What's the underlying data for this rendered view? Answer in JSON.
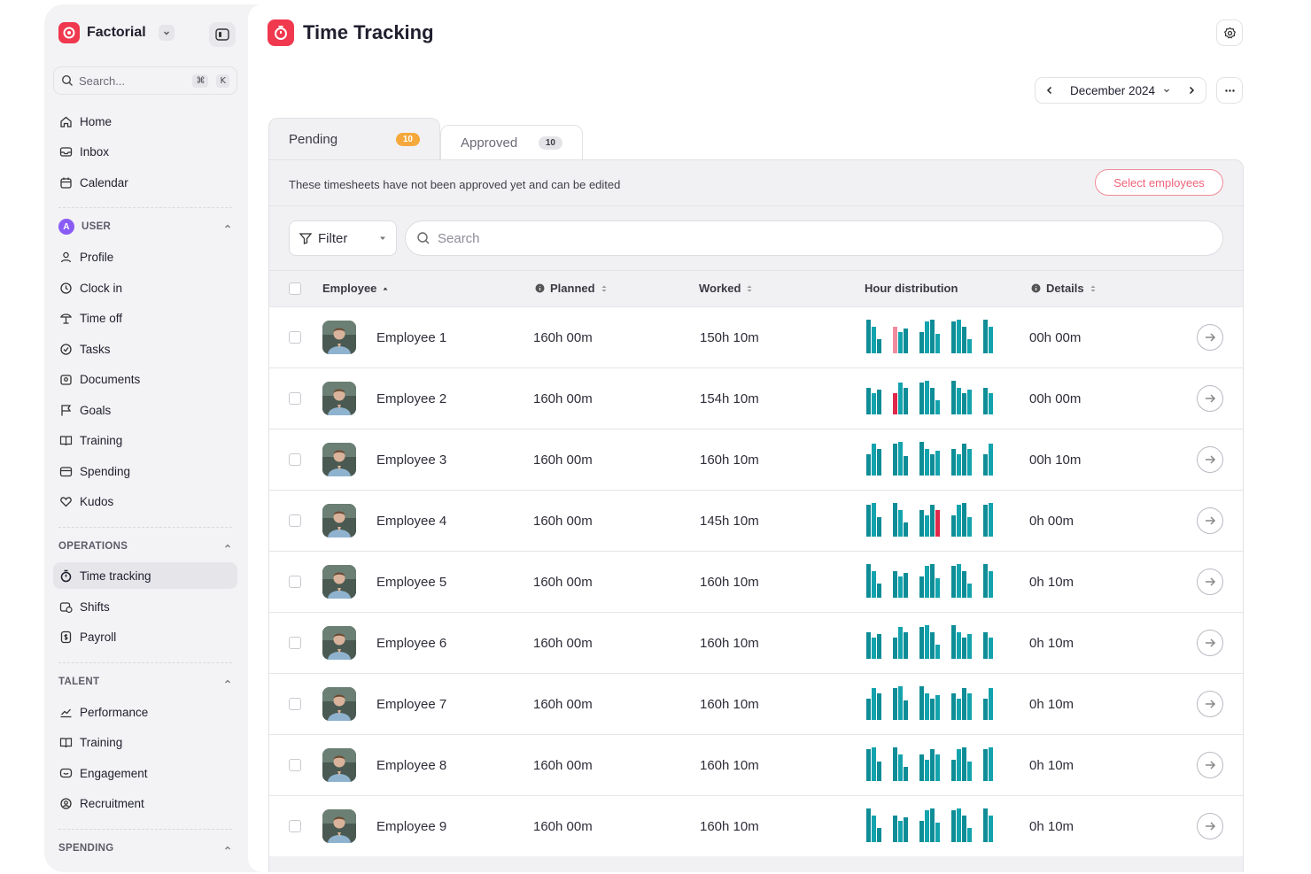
{
  "brand": {
    "name": "Factorial"
  },
  "sidebar": {
    "search_placeholder": "Search...",
    "shortcut": [
      "⌘",
      "K"
    ],
    "top_items": [
      {
        "label": "Home",
        "icon": "home-icon"
      },
      {
        "label": "Inbox",
        "icon": "inbox-icon"
      },
      {
        "label": "Calendar",
        "icon": "calendar-icon"
      }
    ],
    "sections": [
      {
        "title": "USER",
        "badge": "A",
        "items": [
          {
            "label": "Profile",
            "icon": "profile-icon"
          },
          {
            "label": "Clock in",
            "icon": "clock-icon"
          },
          {
            "label": "Time off",
            "icon": "time-off-icon"
          },
          {
            "label": "Tasks",
            "icon": "tasks-icon"
          },
          {
            "label": "Documents",
            "icon": "documents-icon"
          },
          {
            "label": "Goals",
            "icon": "flag-icon"
          },
          {
            "label": "Training",
            "icon": "book-icon"
          },
          {
            "label": "Spending",
            "icon": "wallet-icon"
          },
          {
            "label": "Kudos",
            "icon": "heart-icon"
          }
        ]
      },
      {
        "title": "OPERATIONS",
        "items": [
          {
            "label": "Time tracking",
            "icon": "stopwatch-icon",
            "active": true
          },
          {
            "label": "Shifts",
            "icon": "shifts-icon"
          },
          {
            "label": "Payroll",
            "icon": "payroll-icon"
          }
        ]
      },
      {
        "title": "TALENT",
        "items": [
          {
            "label": "Performance",
            "icon": "performance-icon"
          },
          {
            "label": "Training",
            "icon": "book-icon"
          },
          {
            "label": "Engagement",
            "icon": "engagement-icon"
          },
          {
            "label": "Recruitment",
            "icon": "recruitment-icon"
          }
        ]
      },
      {
        "title": "SPENDING",
        "items": []
      }
    ]
  },
  "header": {
    "title": "Time Tracking",
    "month": "December 2024"
  },
  "tabs": [
    {
      "label": "Pending",
      "count": "10",
      "active": true
    },
    {
      "label": "Approved",
      "count": "10",
      "active": false
    }
  ],
  "panel": {
    "note": "These timesheets have not been approved yet and can be edited",
    "select_button": "Select employees",
    "filter_label": "Filter",
    "search_placeholder": "Search"
  },
  "table": {
    "columns": {
      "employee": "Employee",
      "planned": "Planned",
      "worked": "Worked",
      "distribution": "Hour distribution",
      "details": "Details"
    },
    "rows": [
      {
        "name": "Employee 1",
        "planned": "160h 00m",
        "worked": "150h 10m",
        "details": "00h 00m",
        "alert_bar": 3,
        "alert_color": "#f28b9f"
      },
      {
        "name": "Employee 2",
        "planned": "160h 00m",
        "worked": "154h 10m",
        "details": "00h 00m",
        "alert_bar": 3,
        "alert_color": "#e0284a"
      },
      {
        "name": "Employee 3",
        "planned": "160h 00m",
        "worked": "160h 10m",
        "details": "00h 10m",
        "alert_bar": -1,
        "alert_color": ""
      },
      {
        "name": "Employee 4",
        "planned": "160h 00m",
        "worked": "145h 10m",
        "details": "0h 00m",
        "alert_bar": 9,
        "alert_color": "#e0284a"
      },
      {
        "name": "Employee 5",
        "planned": "160h 00m",
        "worked": "160h 10m",
        "details": "0h 10m",
        "alert_bar": -1,
        "alert_color": ""
      },
      {
        "name": "Employee 6",
        "planned": "160h 00m",
        "worked": "160h 10m",
        "details": "0h 10m",
        "alert_bar": -1,
        "alert_color": ""
      },
      {
        "name": "Employee 7",
        "planned": "160h 00m",
        "worked": "160h 10m",
        "details": "0h 10m",
        "alert_bar": -1,
        "alert_color": ""
      },
      {
        "name": "Employee 8",
        "planned": "160h 00m",
        "worked": "160h 10m",
        "details": "0h 10m",
        "alert_bar": -1,
        "alert_color": ""
      },
      {
        "name": "Employee 9",
        "planned": "160h 00m",
        "worked": "160h 10m",
        "details": "0h 10m",
        "alert_bar": -1,
        "alert_color": ""
      }
    ]
  },
  "colors": {
    "brand": "#f0384f",
    "bar": "#13a3ad",
    "bar_dark": "#0f8d97",
    "pending_badge": "#f5a83b"
  }
}
